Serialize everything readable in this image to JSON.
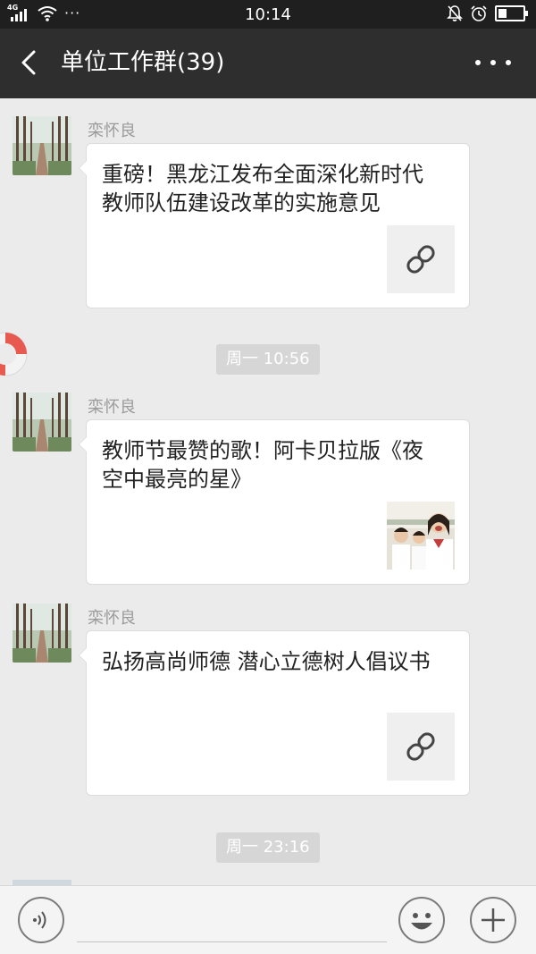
{
  "status_bar": {
    "network": "4G",
    "time": "10:14",
    "overflow": "···",
    "battery_level": 0.35
  },
  "header": {
    "title": "单位工作群(39)",
    "back_icon": "back-chevron-icon",
    "menu_icon": "more-dots-icon"
  },
  "messages": [
    {
      "sender": "栾怀良",
      "text": "重磅！黑龙江发布全面深化新时代教师队伍建设改革的实施意见",
      "thumbnail": "link-icon"
    },
    {
      "sender": "栾怀良",
      "text": "教师节最赞的歌！阿卡贝拉版《夜空中最亮的星》",
      "thumbnail": "photo-thumbnail"
    },
    {
      "sender": "栾怀良",
      "text": "弘扬高尚师德 潜心立德树人倡议书",
      "thumbnail": "link-icon"
    }
  ],
  "timestamps": [
    "周一 10:56",
    "周一 23:16"
  ],
  "input_bar": {
    "voice_icon": "voice-icon",
    "emoji_icon": "emoji-icon",
    "plus_icon": "plus-icon"
  },
  "colors": {
    "titlebar": "#2e2e2e",
    "chat_background": "#ebebeb",
    "timestamp_chip": "#d6d6d6"
  }
}
